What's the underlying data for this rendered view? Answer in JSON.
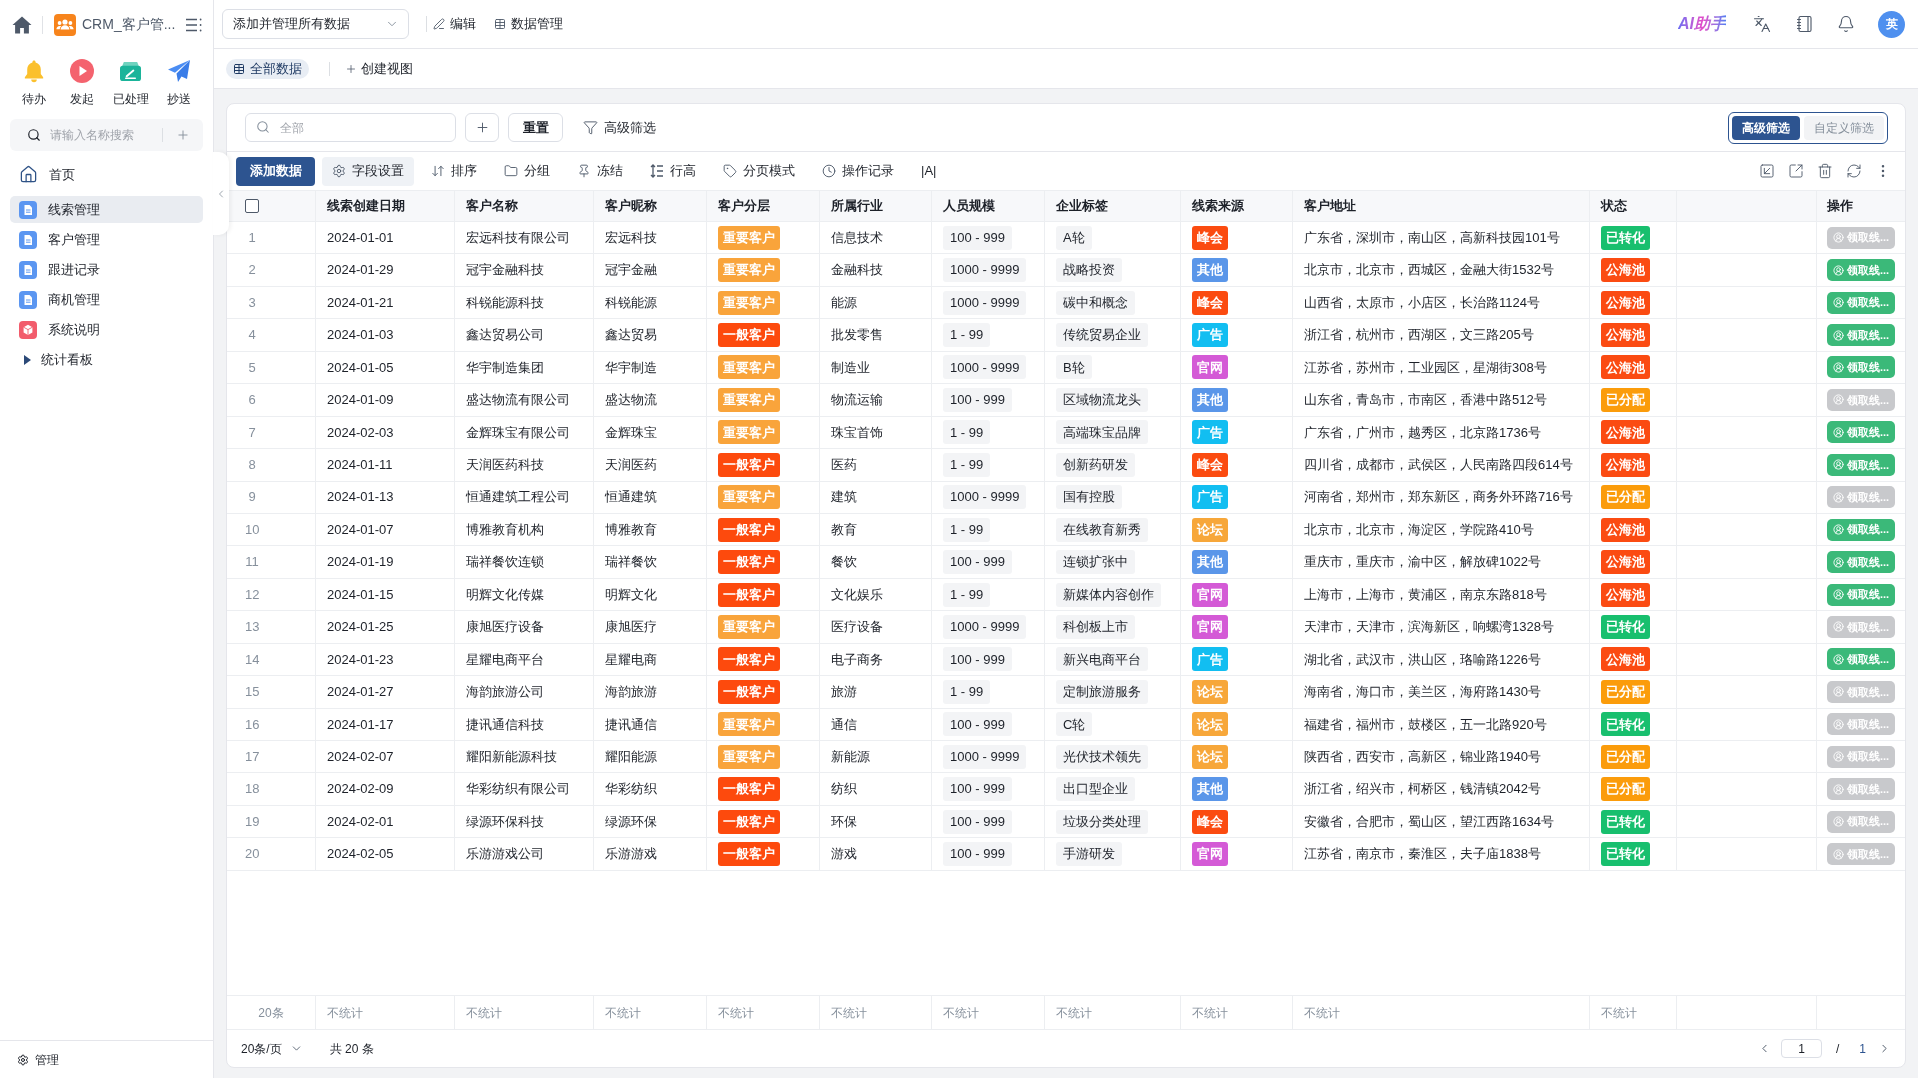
{
  "sidebar": {
    "app_title": "CRM_客户管...",
    "quick_actions": [
      {
        "label": "待办",
        "kind": "todo"
      },
      {
        "label": "发起",
        "kind": "start"
      },
      {
        "label": "已处理",
        "kind": "done"
      },
      {
        "label": "抄送",
        "kind": "cc"
      }
    ],
    "search": {
      "placeholder": "请输入名称搜索"
    },
    "nav": [
      {
        "label": "首页",
        "kind": "home",
        "selected": false
      },
      {
        "label": "线索管理",
        "kind": "page",
        "selected": true
      },
      {
        "label": "客户管理",
        "kind": "page",
        "selected": false
      },
      {
        "label": "跟进记录",
        "kind": "page",
        "selected": false
      },
      {
        "label": "商机管理",
        "kind": "page",
        "selected": false
      },
      {
        "label": "系统说明",
        "kind": "guide",
        "selected": false
      },
      {
        "label": "统计看板",
        "kind": "group",
        "selected": false,
        "expanded": false
      }
    ],
    "footer": "管理"
  },
  "header": {
    "view_select": {
      "value": "添加并管理所有数据"
    },
    "actions": [
      {
        "label": "编辑",
        "kind": "edit"
      },
      {
        "label": "数据管理",
        "kind": "data"
      }
    ],
    "assistant": "AI助手",
    "avatar": "英"
  },
  "views": {
    "tabs": [
      {
        "label": "全部数据",
        "selected": true
      }
    ],
    "create": "创建视图"
  },
  "filter_bar": {
    "search": {
      "placeholder": "全部"
    },
    "reset": "重置",
    "advanced": "高级筛选",
    "mode_toggle": [
      {
        "label": "高级筛选",
        "selected": true
      },
      {
        "label": "自定义筛选",
        "selected": false
      }
    ]
  },
  "toolbar": {
    "primary": "添加数据",
    "items": [
      {
        "label": "字段设置",
        "kind": "fields",
        "selected": true
      },
      {
        "label": "排序",
        "kind": "sort",
        "selected": false
      },
      {
        "label": "分组",
        "kind": "group",
        "selected": false
      },
      {
        "label": "冻结",
        "kind": "freeze",
        "selected": false
      },
      {
        "label": "行高",
        "kind": "row_height",
        "selected": false
      },
      {
        "label": "分页模式",
        "kind": "page_mode",
        "selected": false
      },
      {
        "label": "操作记录",
        "kind": "log",
        "selected": false
      },
      {
        "label": "|A|",
        "kind": "font",
        "selected": false
      }
    ]
  },
  "table": {
    "header_checkbox": {
      "checked": false
    },
    "columns": [
      "线索创建日期",
      "客户名称",
      "客户昵称",
      "客户分层",
      "所属行业",
      "人员规模",
      "企业标签",
      "线索来源",
      "客户地址",
      "状态",
      "操作"
    ],
    "rows": [
      {
        "index": "1",
        "date": "2024-01-01",
        "name": "宏远科技有限公司",
        "nickname": "宏远科技",
        "tier": {
          "text": "重要客户",
          "color": "#f9a43b"
        },
        "industry": "信息技术",
        "size": "100 - 999",
        "tag": "A轮",
        "source": {
          "text": "峰会",
          "color": "#fb4b10"
        },
        "address": "广东省，深圳市，南山区，高新科技园101号",
        "status": {
          "text": "已转化",
          "color": "#18bf6e"
        },
        "action": {
          "label": "领取线...",
          "disabled": true
        }
      },
      {
        "index": "2",
        "date": "2024-01-29",
        "name": "冠宇金融科技",
        "nickname": "冠宇金融",
        "tier": {
          "text": "重要客户",
          "color": "#f9a43b"
        },
        "industry": "金融科技",
        "size": "1000 - 9999",
        "tag": "战略投资",
        "source": {
          "text": "其他",
          "color": "#5a96e9"
        },
        "address": "北京市，北京市，西城区，金融大街1532号",
        "status": {
          "text": "公海池",
          "color": "#fb4b12"
        },
        "action": {
          "label": "领取线...",
          "disabled": false
        }
      },
      {
        "index": "3",
        "date": "2024-01-21",
        "name": "科锐能源科技",
        "nickname": "科锐能源",
        "tier": {
          "text": "重要客户",
          "color": "#f9a43b"
        },
        "industry": "能源",
        "size": "1000 - 9999",
        "tag": "碳中和概念",
        "source": {
          "text": "峰会",
          "color": "#fb4b10"
        },
        "address": "山西省，太原市，小店区，长治路1124号",
        "status": {
          "text": "公海池",
          "color": "#fb4b12"
        },
        "action": {
          "label": "领取线...",
          "disabled": false
        }
      },
      {
        "index": "4",
        "date": "2024-01-03",
        "name": "鑫达贸易公司",
        "nickname": "鑫达贸易",
        "tier": {
          "text": "一般客户",
          "color": "#fd4a0d"
        },
        "industry": "批发零售",
        "size": "1 - 99",
        "tag": "传统贸易企业",
        "source": {
          "text": "广告",
          "color": "#12bef1"
        },
        "address": "浙江省，杭州市，西湖区，文三路205号",
        "status": {
          "text": "公海池",
          "color": "#fb4b12"
        },
        "action": {
          "label": "领取线...",
          "disabled": false
        }
      },
      {
        "index": "5",
        "date": "2024-01-05",
        "name": "华宇制造集团",
        "nickname": "华宇制造",
        "tier": {
          "text": "重要客户",
          "color": "#f9a43b"
        },
        "industry": "制造业",
        "size": "1000 - 9999",
        "tag": "B轮",
        "source": {
          "text": "官网",
          "color": "#d45ad6"
        },
        "address": "江苏省，苏州市，工业园区，星湖街308号",
        "status": {
          "text": "公海池",
          "color": "#fb4b12"
        },
        "action": {
          "label": "领取线...",
          "disabled": false
        }
      },
      {
        "index": "6",
        "date": "2024-01-09",
        "name": "盛达物流有限公司",
        "nickname": "盛达物流",
        "tier": {
          "text": "重要客户",
          "color": "#f9a43b"
        },
        "industry": "物流运输",
        "size": "100 - 999",
        "tag": "区域物流龙头",
        "source": {
          "text": "其他",
          "color": "#5a96e9"
        },
        "address": "山东省，青岛市，市南区，香港中路512号",
        "status": {
          "text": "已分配",
          "color": "#fb9c0b"
        },
        "action": {
          "label": "领取线...",
          "disabled": true
        }
      },
      {
        "index": "7",
        "date": "2024-02-03",
        "name": "金辉珠宝有限公司",
        "nickname": "金辉珠宝",
        "tier": {
          "text": "重要客户",
          "color": "#f9a43b"
        },
        "industry": "珠宝首饰",
        "size": "1 - 99",
        "tag": "高端珠宝品牌",
        "source": {
          "text": "广告",
          "color": "#12bef1"
        },
        "address": "广东省，广州市，越秀区，北京路1736号",
        "status": {
          "text": "公海池",
          "color": "#fb4b12"
        },
        "action": {
          "label": "领取线...",
          "disabled": false
        }
      },
      {
        "index": "8",
        "date": "2024-01-11",
        "name": "天润医药科技",
        "nickname": "天润医药",
        "tier": {
          "text": "一般客户",
          "color": "#fd4a0d"
        },
        "industry": "医药",
        "size": "1 - 99",
        "tag": "创新药研发",
        "source": {
          "text": "峰会",
          "color": "#fb4b10"
        },
        "address": "四川省，成都市，武侯区，人民南路四段614号",
        "status": {
          "text": "公海池",
          "color": "#fb4b12"
        },
        "action": {
          "label": "领取线...",
          "disabled": false
        }
      },
      {
        "index": "9",
        "date": "2024-01-13",
        "name": "恒通建筑工程公司",
        "nickname": "恒通建筑",
        "tier": {
          "text": "重要客户",
          "color": "#f9a43b"
        },
        "industry": "建筑",
        "size": "1000 - 9999",
        "tag": "国有控股",
        "source": {
          "text": "广告",
          "color": "#12bef1"
        },
        "address": "河南省，郑州市，郑东新区，商务外环路716号",
        "status": {
          "text": "已分配",
          "color": "#fb9c0b"
        },
        "action": {
          "label": "领取线...",
          "disabled": true
        }
      },
      {
        "index": "10",
        "date": "2024-01-07",
        "name": "博雅教育机构",
        "nickname": "博雅教育",
        "tier": {
          "text": "一般客户",
          "color": "#fd4a0d"
        },
        "industry": "教育",
        "size": "1 - 99",
        "tag": "在线教育新秀",
        "source": {
          "text": "论坛",
          "color": "#f7a73a"
        },
        "address": "北京市，北京市，海淀区，学院路410号",
        "status": {
          "text": "公海池",
          "color": "#fb4b12"
        },
        "action": {
          "label": "领取线...",
          "disabled": false
        }
      },
      {
        "index": "11",
        "date": "2024-01-19",
        "name": "瑞祥餐饮连锁",
        "nickname": "瑞祥餐饮",
        "tier": {
          "text": "一般客户",
          "color": "#fd4a0d"
        },
        "industry": "餐饮",
        "size": "100 - 999",
        "tag": "连锁扩张中",
        "source": {
          "text": "其他",
          "color": "#5a96e9"
        },
        "address": "重庆市，重庆市，渝中区，解放碑1022号",
        "status": {
          "text": "公海池",
          "color": "#fb4b12"
        },
        "action": {
          "label": "领取线...",
          "disabled": false
        }
      },
      {
        "index": "12",
        "date": "2024-01-15",
        "name": "明辉文化传媒",
        "nickname": "明辉文化",
        "tier": {
          "text": "一般客户",
          "color": "#fd4a0d"
        },
        "industry": "文化娱乐",
        "size": "1 - 99",
        "tag": "新媒体内容创作",
        "source": {
          "text": "官网",
          "color": "#d45ad6"
        },
        "address": "上海市，上海市，黄浦区，南京东路818号",
        "status": {
          "text": "公海池",
          "color": "#fb4b12"
        },
        "action": {
          "label": "领取线...",
          "disabled": false
        }
      },
      {
        "index": "13",
        "date": "2024-01-25",
        "name": "康旭医疗设备",
        "nickname": "康旭医疗",
        "tier": {
          "text": "重要客户",
          "color": "#f9a43b"
        },
        "industry": "医疗设备",
        "size": "1000 - 9999",
        "tag": "科创板上市",
        "source": {
          "text": "官网",
          "color": "#d45ad6"
        },
        "address": "天津市，天津市，滨海新区，响螺湾1328号",
        "status": {
          "text": "已转化",
          "color": "#18bf6e"
        },
        "action": {
          "label": "领取线...",
          "disabled": true
        }
      },
      {
        "index": "14",
        "date": "2024-01-23",
        "name": "星耀电商平台",
        "nickname": "星耀电商",
        "tier": {
          "text": "一般客户",
          "color": "#fd4a0d"
        },
        "industry": "电子商务",
        "size": "100 - 999",
        "tag": "新兴电商平台",
        "source": {
          "text": "广告",
          "color": "#12bef1"
        },
        "address": "湖北省，武汉市，洪山区，珞喻路1226号",
        "status": {
          "text": "公海池",
          "color": "#fb4b12"
        },
        "action": {
          "label": "领取线...",
          "disabled": false
        }
      },
      {
        "index": "15",
        "date": "2024-01-27",
        "name": "海韵旅游公司",
        "nickname": "海韵旅游",
        "tier": {
          "text": "一般客户",
          "color": "#fd4a0d"
        },
        "industry": "旅游",
        "size": "1 - 99",
        "tag": "定制旅游服务",
        "source": {
          "text": "论坛",
          "color": "#f7a73a"
        },
        "address": "海南省，海口市，美兰区，海府路1430号",
        "status": {
          "text": "已分配",
          "color": "#fb9c0b"
        },
        "action": {
          "label": "领取线...",
          "disabled": true
        }
      },
      {
        "index": "16",
        "date": "2024-01-17",
        "name": "捷讯通信科技",
        "nickname": "捷讯通信",
        "tier": {
          "text": "重要客户",
          "color": "#f9a43b"
        },
        "industry": "通信",
        "size": "100 - 999",
        "tag": "C轮",
        "source": {
          "text": "论坛",
          "color": "#f7a73a"
        },
        "address": "福建省，福州市，鼓楼区，五一北路920号",
        "status": {
          "text": "已转化",
          "color": "#18bf6e"
        },
        "action": {
          "label": "领取线...",
          "disabled": true
        }
      },
      {
        "index": "17",
        "date": "2024-02-07",
        "name": "耀阳新能源科技",
        "nickname": "耀阳能源",
        "tier": {
          "text": "重要客户",
          "color": "#f9a43b"
        },
        "industry": "新能源",
        "size": "1000 - 9999",
        "tag": "光伏技术领先",
        "source": {
          "text": "论坛",
          "color": "#f7a73a"
        },
        "address": "陕西省，西安市，高新区，锦业路1940号",
        "status": {
          "text": "已分配",
          "color": "#fb9c0b"
        },
        "action": {
          "label": "领取线...",
          "disabled": true
        }
      },
      {
        "index": "18",
        "date": "2024-02-09",
        "name": "华彩纺织有限公司",
        "nickname": "华彩纺织",
        "tier": {
          "text": "一般客户",
          "color": "#fd4a0d"
        },
        "industry": "纺织",
        "size": "100 - 999",
        "tag": "出口型企业",
        "source": {
          "text": "其他",
          "color": "#5a96e9"
        },
        "address": "浙江省，绍兴市，柯桥区，钱清镇2042号",
        "status": {
          "text": "已分配",
          "color": "#fb9c0b"
        },
        "action": {
          "label": "领取线...",
          "disabled": true
        }
      },
      {
        "index": "19",
        "date": "2024-02-01",
        "name": "绿源环保科技",
        "nickname": "绿源环保",
        "tier": {
          "text": "一般客户",
          "color": "#fd4a0d"
        },
        "industry": "环保",
        "size": "100 - 999",
        "tag": "垃圾分类处理",
        "source": {
          "text": "峰会",
          "color": "#fb4b10"
        },
        "address": "安徽省，合肥市，蜀山区，望江西路1634号",
        "status": {
          "text": "已转化",
          "color": "#18bf6e"
        },
        "action": {
          "label": "领取线...",
          "disabled": true
        }
      },
      {
        "index": "20",
        "date": "2024-02-05",
        "name": "乐游游戏公司",
        "nickname": "乐游游戏",
        "tier": {
          "text": "一般客户",
          "color": "#fd4a0d"
        },
        "industry": "游戏",
        "size": "100 - 999",
        "tag": "手游研发",
        "source": {
          "text": "官网",
          "color": "#d45ad6"
        },
        "address": "江苏省，南京市，秦淮区，夫子庙1838号",
        "status": {
          "text": "已转化",
          "color": "#18bf6e"
        },
        "action": {
          "label": "领取线...",
          "disabled": true
        }
      }
    ]
  },
  "summary": {
    "count": "20条",
    "cells": [
      "不统计",
      "不统计",
      "不统计",
      "不统计",
      "不统计",
      "不统计",
      "不统计",
      "不统计",
      "不统计",
      "不统计"
    ]
  },
  "pagination": {
    "page_size": "20条/页",
    "total": "共 20 条",
    "page": "1",
    "separator": "/",
    "pages": "1"
  }
}
